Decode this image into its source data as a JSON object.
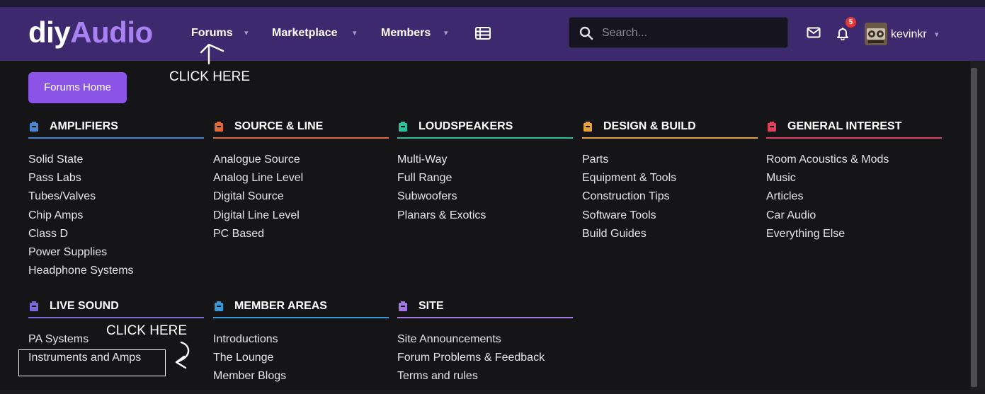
{
  "header": {
    "logo_part1": "diy",
    "logo_part2": "Audio",
    "nav": [
      {
        "label": "Forums"
      },
      {
        "label": "Marketplace"
      },
      {
        "label": "Members"
      }
    ],
    "caret_glyph": "▾",
    "list_icon": "list-icon",
    "search_placeholder": "Search...",
    "notification_count": "5",
    "username": "kevinkr"
  },
  "forums_home_label": "Forums Home",
  "annotations": {
    "top": "CLICK HERE",
    "bottom": "CLICK HERE"
  },
  "categories": [
    {
      "title": "AMPLIFIERS",
      "color": "#4a86d0",
      "links": [
        "Solid State",
        "Pass Labs",
        "Tubes/Valves",
        "Chip Amps",
        "Class D",
        "Power Supplies",
        "Headphone Systems"
      ]
    },
    {
      "title": "SOURCE & LINE",
      "color": "#e06a3c",
      "links": [
        "Analogue Source",
        "Analog Line Level",
        "Digital Source",
        "Digital Line Level",
        "PC Based"
      ]
    },
    {
      "title": "LOUDSPEAKERS",
      "color": "#2fbf9a",
      "links": [
        "Multi-Way",
        "Full Range",
        "Subwoofers",
        "Planars & Exotics"
      ]
    },
    {
      "title": "DESIGN & BUILD",
      "color": "#e6a23a",
      "links": [
        "Parts",
        "Equipment & Tools",
        "Construction Tips",
        "Software Tools",
        "Build Guides"
      ]
    },
    {
      "title": "GENERAL INTEREST",
      "color": "#e0405a",
      "links": [
        "Room Acoustics & Mods",
        "Music",
        "Articles",
        "Car Audio",
        "Everything Else"
      ]
    },
    {
      "title": "LIVE SOUND",
      "color": "#7a6cd8",
      "links": [
        "PA Systems",
        "Instruments and Amps"
      ]
    },
    {
      "title": "MEMBER AREAS",
      "color": "#3a9ad8",
      "links": [
        "Introductions",
        "The Lounge",
        "Member Blogs"
      ]
    },
    {
      "title": "SITE",
      "color": "#a078e0",
      "links": [
        "Site Announcements",
        "Forum Problems & Feedback",
        "Terms and rules"
      ]
    }
  ]
}
